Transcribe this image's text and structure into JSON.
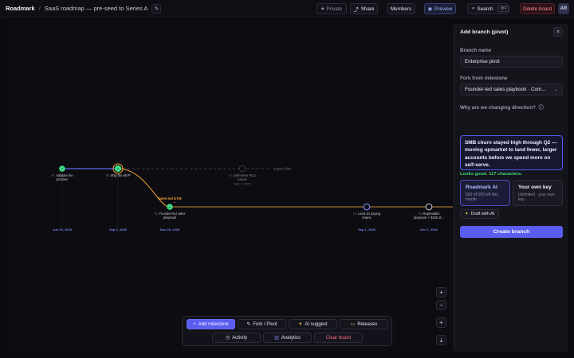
{
  "topbar": {
    "brand": "Roadmark",
    "separator": "/",
    "board_title": "SaaS roadmap — pre-seed to Series A",
    "privacy_label": "Private",
    "share_label": "Share",
    "members_label": "Members",
    "preview_label": "Preview",
    "search_label": "Search",
    "search_shortcut": "⌘K",
    "delete_label": "Delete board",
    "avatar_initials": "AR"
  },
  "roadmap": {
    "original_plan_label": "original plan",
    "pivot_tag": "Sales-led GTM",
    "milestones": [
      {
        "number": "#1",
        "title": "Validate the",
        "title2": "problem",
        "date": "Jun 10, 2025",
        "status": "done"
      },
      {
        "number": "#2",
        "title": "Ship the MVP",
        "title2": "",
        "date": "Sep 1, 2025",
        "status": "done"
      },
      {
        "number": "#3",
        "title": "Self-serve PLG",
        "title2": "funnel",
        "date": "",
        "sub_date": "Mar 1, 2026",
        "status": "ghost"
      },
      {
        "number": "#1",
        "title": "Founder-led sales",
        "title2": "playbook",
        "date": "Nov 20, 2025",
        "status": "done"
      },
      {
        "number": "#2",
        "title": "Land 10 paying",
        "title2": "teams",
        "date": "Sep 1, 2026",
        "status": "open"
      },
      {
        "number": "#3",
        "title": "Repeatable",
        "title2": "playbook + $10k M...",
        "date": "Dec 1, 2026",
        "status": "open"
      }
    ]
  },
  "zoom": {
    "in": "+",
    "out": "−",
    "fit": "+",
    "export": "⤓"
  },
  "toolbar": {
    "add_milestone": "Add milestone",
    "fork_pivot": "Fork / Pivot",
    "ai_suggest": "AI suggest",
    "releases": "Releases",
    "activity": "Activity",
    "analytics": "Analytics",
    "clear_board": "Clear board"
  },
  "panel": {
    "title": "Add branch (pivot)",
    "close": "×",
    "branch_name_label": "Branch name",
    "branch_name_value": "Enterprise pivot",
    "fork_label": "Fork from milestone",
    "fork_value": "Founder-led sales playbook · Com...",
    "why_label": "Why are we changing direction?",
    "why_value": "SMB churn stayed high through Q2 — moving upmarket to land fewer, larger accounts before we spend more on self-serve.",
    "validation": "Looks good. 117 characters.",
    "option_ai_title": "Roadmark AI",
    "option_ai_sub": "500 of 500 left this month",
    "option_key_title": "Your own key",
    "option_key_sub": "Unlimited · your own key",
    "draft_label": "Draft with AI",
    "create_label": "Create branch"
  },
  "colors": {
    "accent": "#5b5cf0",
    "done": "#3ddc84",
    "pivot": "#f0a030",
    "main_line": "#5b6cf0"
  }
}
